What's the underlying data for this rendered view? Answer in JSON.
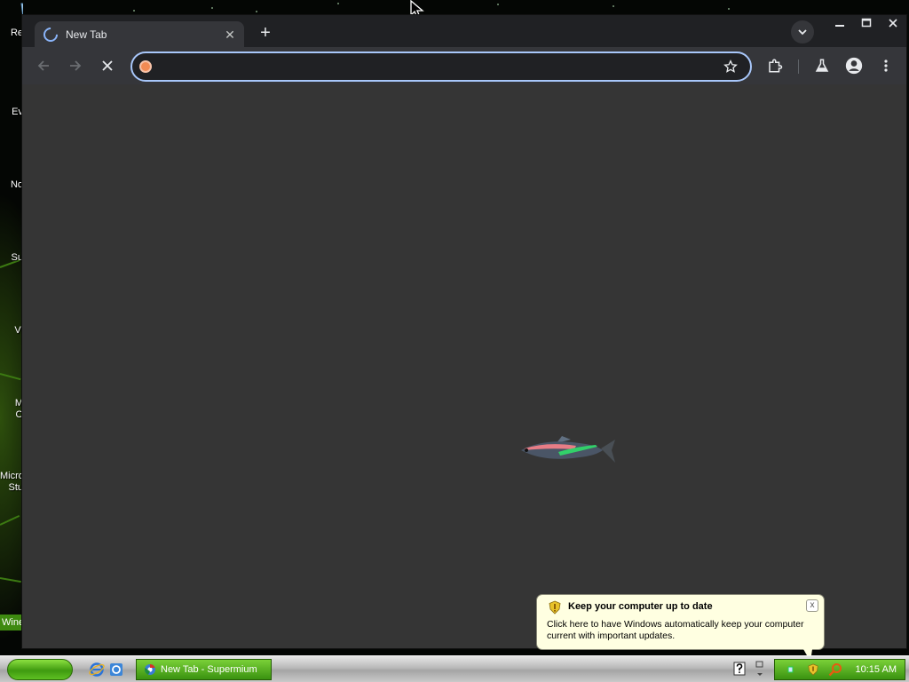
{
  "desktop": {
    "icon_labels": [
      "Re",
      "Ev",
      "No",
      "Su",
      "Vi",
      "M\nO",
      "Micro\nStu"
    ],
    "wine_label": "Wine"
  },
  "browser": {
    "tab": {
      "title": "New Tab",
      "loading": true
    },
    "new_tab_symbol": "+",
    "tab_close_symbol": "✕",
    "omnibox": {
      "value": "",
      "placeholder": ""
    },
    "nav": {
      "back_enabled": false,
      "forward_enabled": false,
      "stop_shown": true
    },
    "window_controls": [
      "minimize",
      "maximize",
      "close"
    ],
    "icons": {
      "back": "arrow-left-icon",
      "forward": "arrow-right-icon",
      "stop": "close-x-icon",
      "bookmark": "star-outline-icon",
      "extensions": "puzzle-icon",
      "labs": "flask-icon",
      "profile": "person-icon",
      "menu": "three-dots-icon",
      "tab_search": "chevron-down-icon"
    },
    "colors": {
      "frame": "#202124",
      "toolbar": "#35363a",
      "content": "#353535",
      "focus_ring": "#a8c7fa"
    }
  },
  "notification": {
    "title": "Keep your computer up to date",
    "body": "Click here to have Windows automatically keep your computer current with important updates.",
    "close_symbol": "x"
  },
  "taskbar": {
    "task_button": "New Tab - Supermium",
    "clock": "10:15 AM"
  }
}
